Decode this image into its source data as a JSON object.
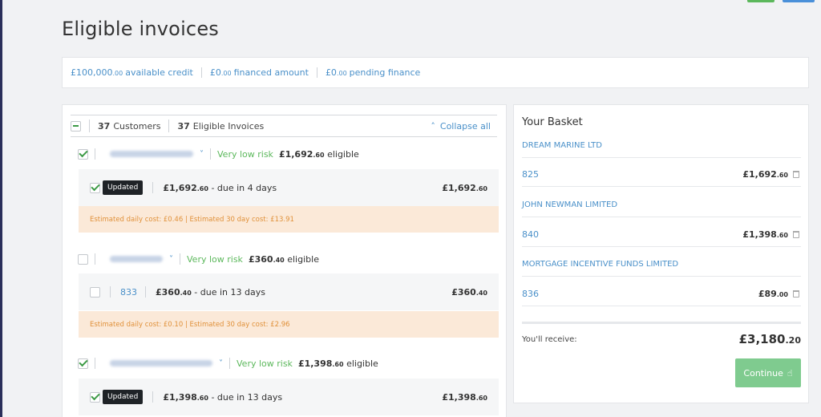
{
  "page_title": "Eligible invoices",
  "credit": {
    "available": {
      "main": "£100,000",
      "dec": ".00",
      "label": "available credit"
    },
    "financed": {
      "main": "£0",
      "dec": ".00",
      "label": "financed amount"
    },
    "pending": {
      "main": "£0",
      "dec": ".00",
      "label": "pending finance"
    }
  },
  "list_header": {
    "customers_count": "37",
    "customers_label": "Customers",
    "invoices_count": "37",
    "invoices_label": "Eligible Invoices",
    "collapse_label": "Collapse all"
  },
  "customers": [
    {
      "risk": "Very low risk",
      "eligible_main": "£1,692",
      "eligible_dec": ".60",
      "eligible_suffix": "eligible",
      "invoice": {
        "tag": "Updated",
        "due_main": "£1,692",
        "due_dec": ".60",
        "due_text": "- due in 4 days",
        "amount_main": "£1,692",
        "amount_dec": ".60"
      },
      "cost": "Estimated daily cost: £0.46 | Estimated 30 day cost: £13.91"
    },
    {
      "risk": "Very low risk",
      "eligible_main": "£360",
      "eligible_dec": ".40",
      "eligible_suffix": "eligible",
      "invoice": {
        "number": "833",
        "due_main": "£360",
        "due_dec": ".40",
        "due_text": "- due in 13 days",
        "amount_main": "£360",
        "amount_dec": ".40"
      },
      "cost": "Estimated daily cost: £0.10 | Estimated 30 day cost: £2.96"
    },
    {
      "risk": "Very low risk",
      "eligible_main": "£1,398",
      "eligible_dec": ".60",
      "eligible_suffix": "eligible",
      "invoice": {
        "tag": "Updated",
        "due_main": "£1,398",
        "due_dec": ".60",
        "due_text": "- due in 13 days",
        "amount_main": "£1,398",
        "amount_dec": ".60"
      }
    }
  ],
  "basket": {
    "title": "Your Basket",
    "items": [
      {
        "customer": "DREAM MARINE LTD",
        "invoice": "825",
        "amount_main": "£1,692",
        "amount_dec": ".60"
      },
      {
        "customer": "JOHN NEWMAN LIMITED",
        "invoice": "840",
        "amount_main": "£1,398",
        "amount_dec": ".60"
      },
      {
        "customer": "MORTGAGE INCENTIVE FUNDS LIMITED",
        "invoice": "836",
        "amount_main": "£89",
        "amount_dec": ".00"
      }
    ],
    "receive_label": "You'll receive:",
    "receive_main": "£3,180",
    "receive_dec": ".20",
    "continue_label": "Continue"
  },
  "colors": {
    "accent": "#4a90c9",
    "success": "#5cb85c",
    "warning_bg": "#fbe9d8",
    "warning_text": "#e0913a"
  }
}
